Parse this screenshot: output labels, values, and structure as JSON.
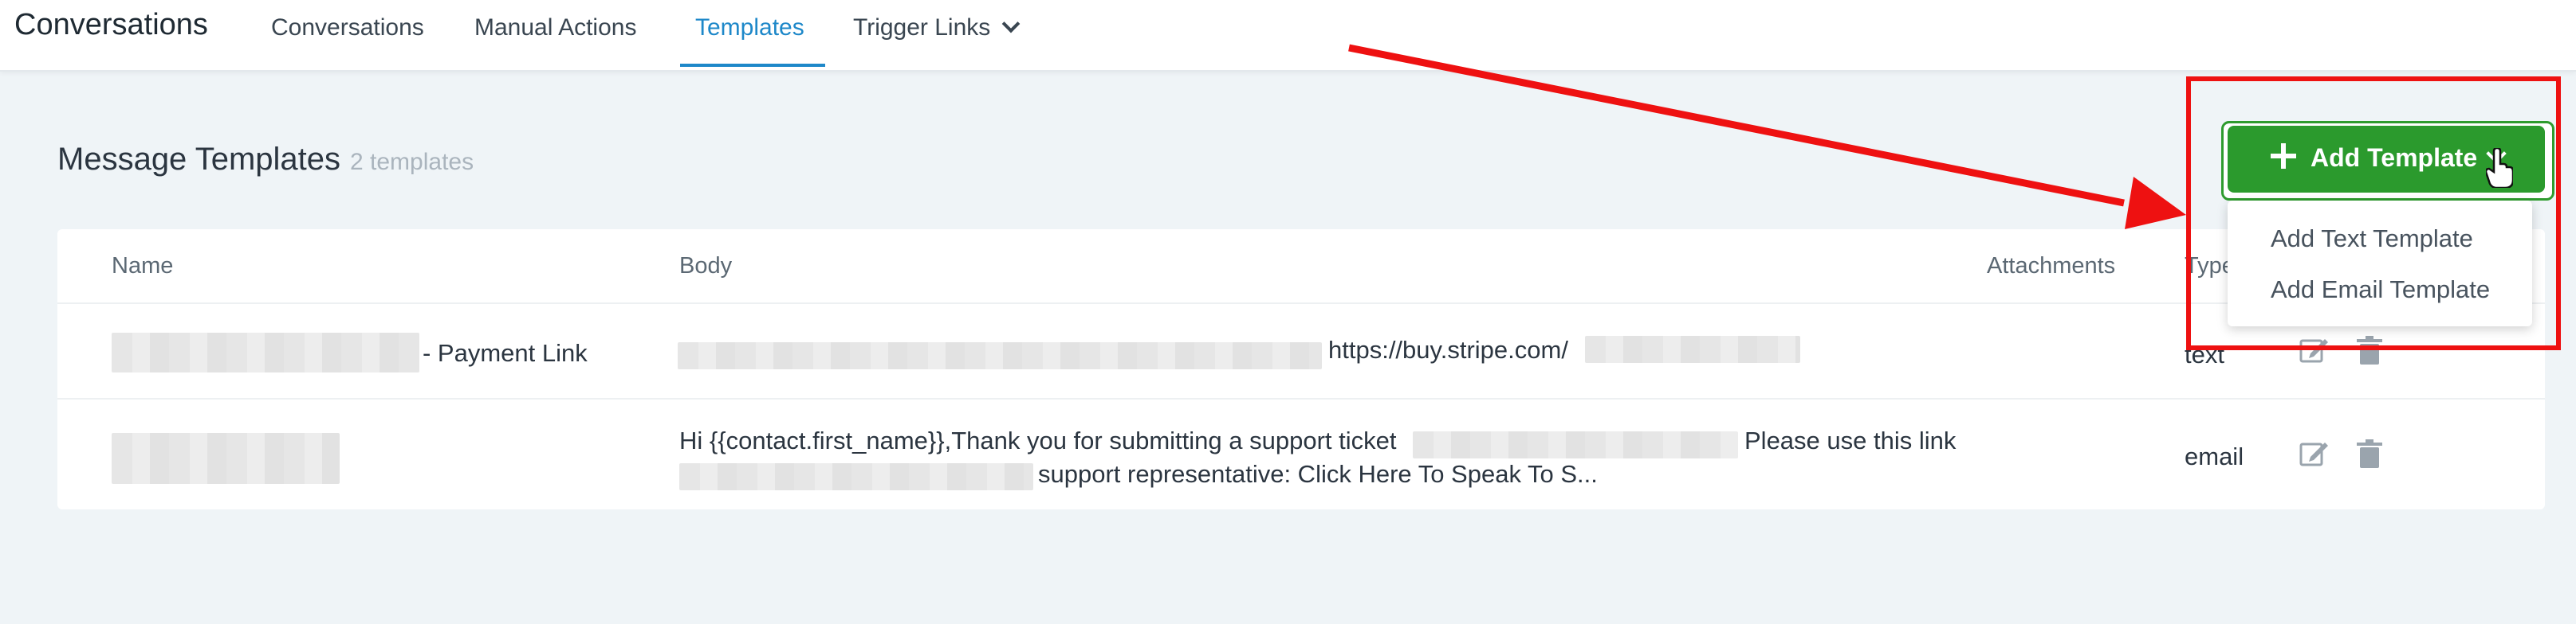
{
  "app": {
    "title": "Conversations"
  },
  "nav": {
    "items": [
      {
        "label": "Conversations"
      },
      {
        "label": "Manual Actions"
      },
      {
        "label": "Templates",
        "active": true
      },
      {
        "label": "Trigger Links",
        "has_dropdown": true
      }
    ]
  },
  "header": {
    "title": "Message Templates",
    "count": "2 templates"
  },
  "add_button": {
    "label": "Add Template",
    "menu": [
      "Add Text Template",
      "Add Email Template"
    ]
  },
  "table": {
    "columns": [
      "Name",
      "Body",
      "Attachments",
      "Type"
    ],
    "rows": [
      {
        "name_suffix": "- Payment Link",
        "body": "https://buy.stripe.com/",
        "type": "text"
      },
      {
        "name_suffix": "",
        "body_line1_a": "Hi {{contact.first_name}},Thank you for submitting a support ticket",
        "body_line1_b": "Please use this link",
        "body_line2": "support representative: Click Here To Speak To S...",
        "type": "email"
      }
    ]
  },
  "colors": {
    "accent": "#1e88c9",
    "button_green": "#2b9a2d",
    "annotation": "#ee1111"
  },
  "icons": [
    "chevron-down-icon",
    "plus-icon",
    "edit-icon",
    "trash-icon",
    "hand-cursor-icon"
  ]
}
